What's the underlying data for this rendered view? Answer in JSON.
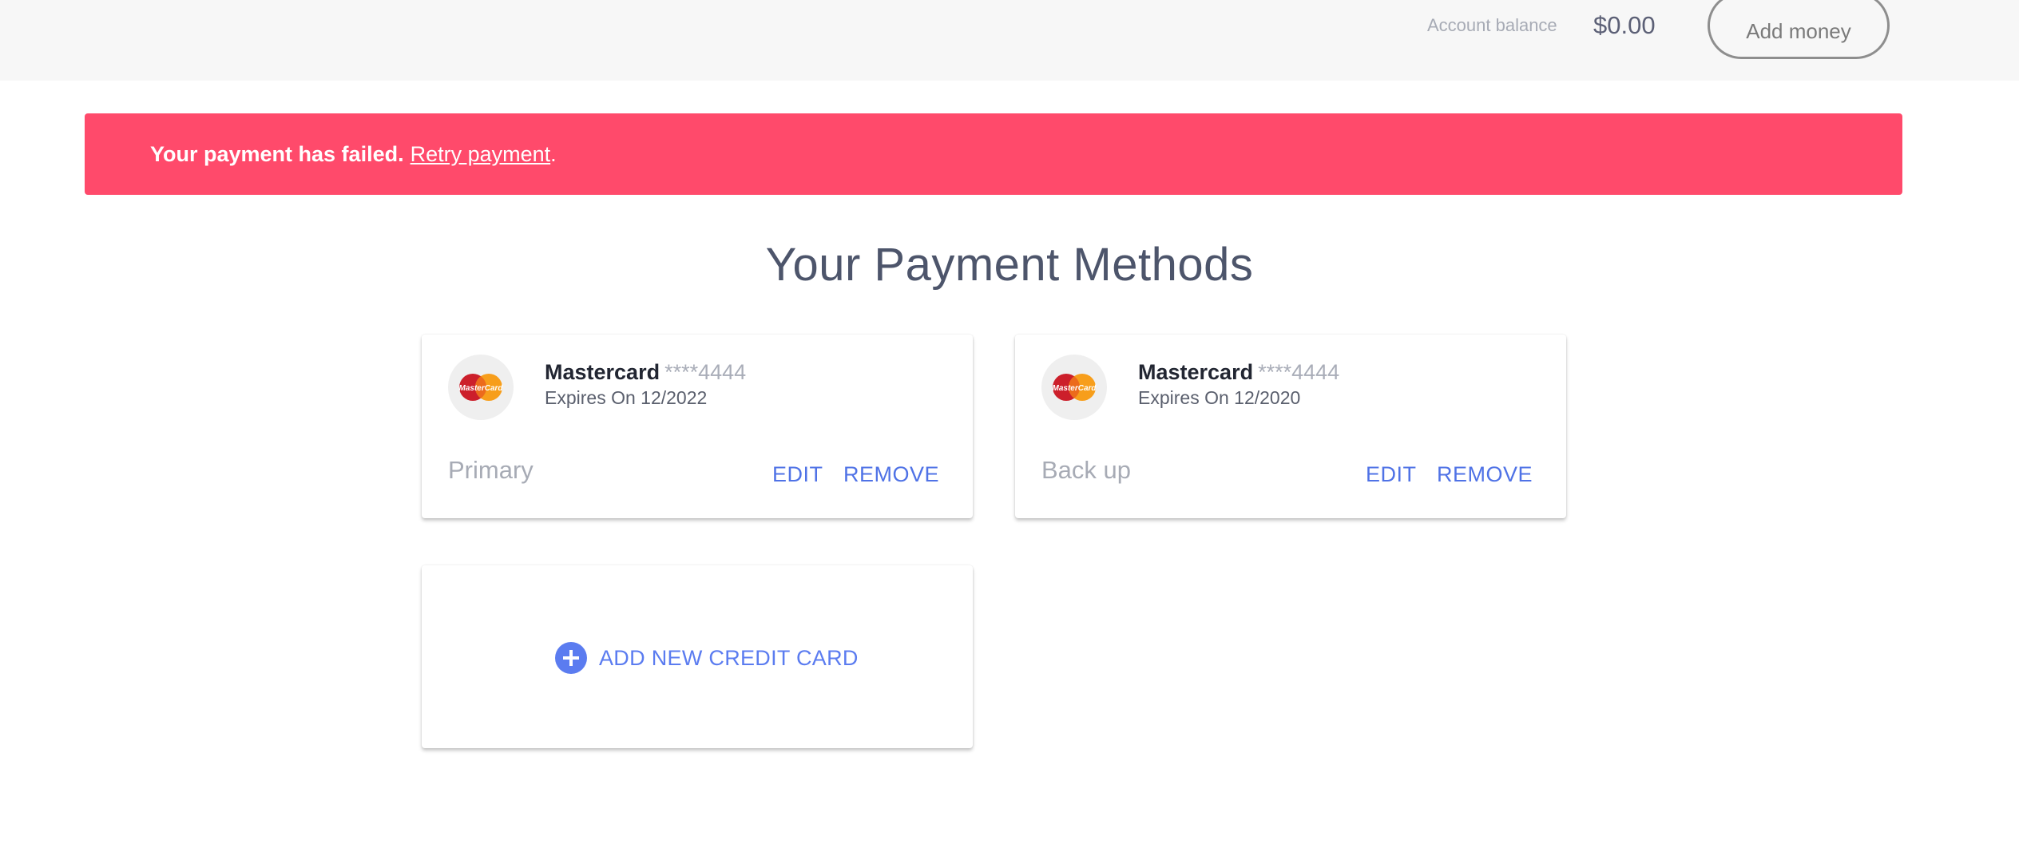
{
  "header": {
    "balance_label": "Account balance",
    "balance_value": "$0.00",
    "add_money_label": "Add money"
  },
  "alert": {
    "message": "Your payment has failed.",
    "retry_label": "Retry payment",
    "suffix": ".",
    "color": "#ff4a6b"
  },
  "page": {
    "title": "Your Payment Methods"
  },
  "cards": [
    {
      "brand": "Mastercard",
      "masked_number": "****4444",
      "expiry": "Expires On 12/2022",
      "role": "Primary",
      "edit_label": "EDIT",
      "remove_label": "REMOVE",
      "logo_icon": "mastercard-logo-icon"
    },
    {
      "brand": "Mastercard",
      "masked_number": "****4444",
      "expiry": "Expires On 12/2020",
      "role": "Back up",
      "edit_label": "EDIT",
      "remove_label": "REMOVE",
      "logo_icon": "mastercard-logo-icon"
    }
  ],
  "add_card": {
    "label": "ADD NEW CREDIT CARD",
    "icon": "plus-circle-icon"
  },
  "colors": {
    "accent": "#4f72e6",
    "alert": "#ff4a6b",
    "header_bg": "#f7f7f7"
  }
}
